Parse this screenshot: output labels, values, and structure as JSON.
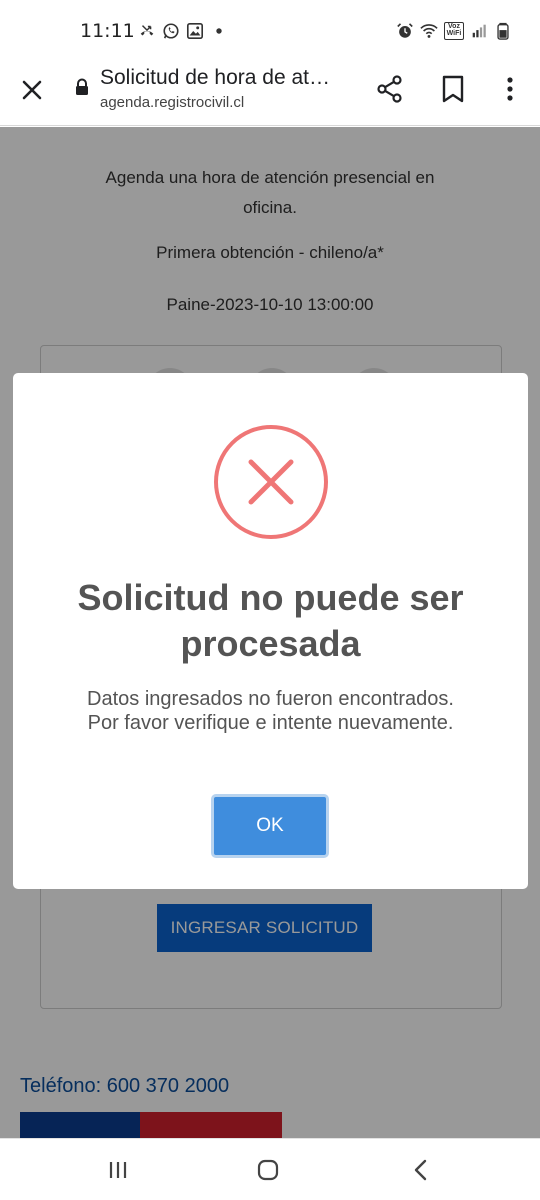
{
  "status_bar": {
    "time": "11:11",
    "left_icons": [
      "missed-call-icon",
      "whatsapp-icon",
      "gallery-icon",
      "notification-dot-icon"
    ],
    "right_icons": [
      "alarm-icon",
      "wifi-icon",
      "vowifi-icon",
      "signal-icon",
      "battery-icon"
    ],
    "vowifi_label_line1": "Voz",
    "vowifi_label_line2": "WiFi"
  },
  "browser": {
    "title": "Solicitud de hora de at…",
    "url": "agenda.registrocivil.cl"
  },
  "page": {
    "heading": "Agenda una hora de atención presencial en oficina.",
    "procedure": "Primera obtención - chileno/a*",
    "appointment": "Paine-2023-10-10 13:00:00",
    "submit_button": "INGRESAR SOLICITUD",
    "phone": "Teléfono: 600 370 2000"
  },
  "modal": {
    "icon": "error-x-icon",
    "icon_color": "#ef7676",
    "title": "Solicitud no puede ser procesada",
    "message": "Datos ingresados no fueron encontrados. Por favor verifique e intente nuevamente.",
    "ok_button": "OK"
  },
  "colors": {
    "primary_button": "#0a63cf",
    "ok_button": "#3f8ddd",
    "link": "#0a4d9b",
    "stripe_blue": "#0a3d8f",
    "stripe_red": "#d1202e"
  }
}
